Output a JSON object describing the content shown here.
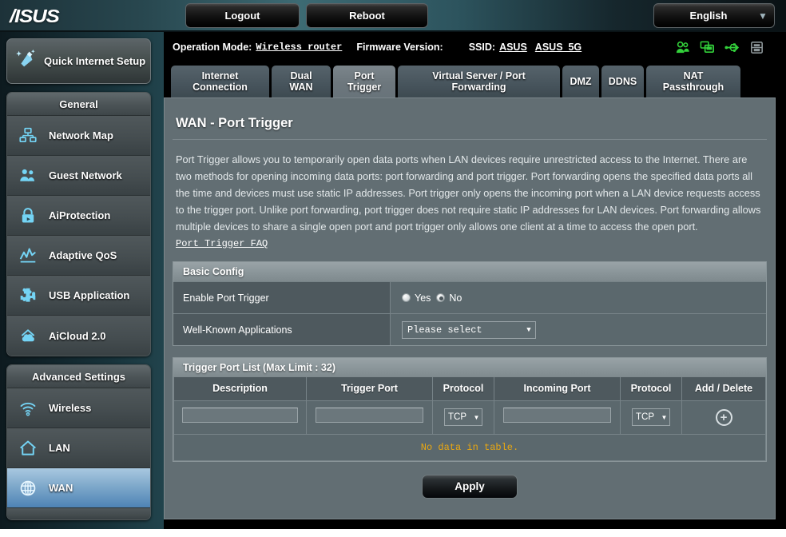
{
  "topbar": {
    "logo": "/ISUS",
    "logout_label": "Logout",
    "reboot_label": "Reboot",
    "language": "English",
    "caret": "▼"
  },
  "infobar": {
    "operation_mode_label": "Operation Mode:",
    "operation_mode_value": "Wireless router",
    "firmware_label": "Firmware Version:",
    "firmware_value": "",
    "ssid_label": "SSID:",
    "ssid_1": "ASUS",
    "ssid_2": "ASUS_5G",
    "icons": [
      "clients-icon",
      "devices-icon",
      "usb-icon",
      "printer-icon"
    ]
  },
  "sidebar": {
    "quick_setup": {
      "label": "Quick Internet Setup",
      "icon": "magic-wand-icon"
    },
    "groups": [
      {
        "title": "General",
        "items": [
          {
            "label": "Network Map",
            "icon": "network-map-icon",
            "active": false
          },
          {
            "label": "Guest Network",
            "icon": "guest-network-icon",
            "active": false
          },
          {
            "label": "AiProtection",
            "icon": "lock-icon",
            "active": false
          },
          {
            "label": "Adaptive QoS",
            "icon": "chart-icon",
            "active": false
          },
          {
            "label": "USB Application",
            "icon": "puzzle-icon",
            "active": false
          },
          {
            "label": "AiCloud 2.0",
            "icon": "cloud-icon",
            "active": false
          }
        ]
      },
      {
        "title": "Advanced Settings",
        "items": [
          {
            "label": "Wireless",
            "icon": "wifi-icon",
            "active": false
          },
          {
            "label": "LAN",
            "icon": "home-icon",
            "active": false
          },
          {
            "label": "WAN",
            "icon": "globe-icon",
            "active": true
          }
        ]
      }
    ]
  },
  "tabs": [
    {
      "label": "Internet Connection",
      "active": false
    },
    {
      "label": "Dual WAN",
      "active": false
    },
    {
      "label": "Port Trigger",
      "active": true
    },
    {
      "label": "Virtual Server / Port Forwarding",
      "active": false
    },
    {
      "label": "DMZ",
      "active": false
    },
    {
      "label": "DDNS",
      "active": false
    },
    {
      "label": "NAT Passthrough",
      "active": false
    }
  ],
  "main": {
    "page_title": "WAN - Port Trigger",
    "description": "Port Trigger allows you to temporarily open data ports when LAN devices require unrestricted access to the Internet. There are two methods for opening incoming data ports: port forwarding and port trigger. Port forwarding opens the specified data ports all the time and devices must use static IP addresses. Port trigger only opens the incoming port when a LAN device requests access to the trigger port. Unlike port forwarding, port trigger does not require static IP addresses for LAN devices. Port forwarding allows multiple devices to share a single open port and port trigger only allows one client at a time to access the open port.",
    "faq_link": "Port Trigger FAQ",
    "basic_config": {
      "heading": "Basic Config",
      "enable_label": "Enable Port Trigger",
      "enable_yes": "Yes",
      "enable_no": "No",
      "enable_value": "No",
      "wka_label": "Well-Known Applications",
      "wka_value": "Please select",
      "caret": "▼"
    },
    "trigger_table": {
      "heading": "Trigger Port List (Max Limit : 32)",
      "columns": [
        "Description",
        "Trigger Port",
        "Protocol",
        "Incoming Port",
        "Protocol",
        "Add / Delete"
      ],
      "entry_row": {
        "description": "",
        "trigger_port": "",
        "protocol_1": "TCP",
        "incoming_port": "",
        "protocol_2": "TCP",
        "add_glyph": "+"
      },
      "empty_message": "No data in table.",
      "rows": []
    },
    "apply_label": "Apply"
  },
  "colors": {
    "panel_bg": "#626e73",
    "accent_cyan": "#74d4f5",
    "active_nav": "#7fa9cb",
    "warning_yellow": "#e8a712"
  }
}
